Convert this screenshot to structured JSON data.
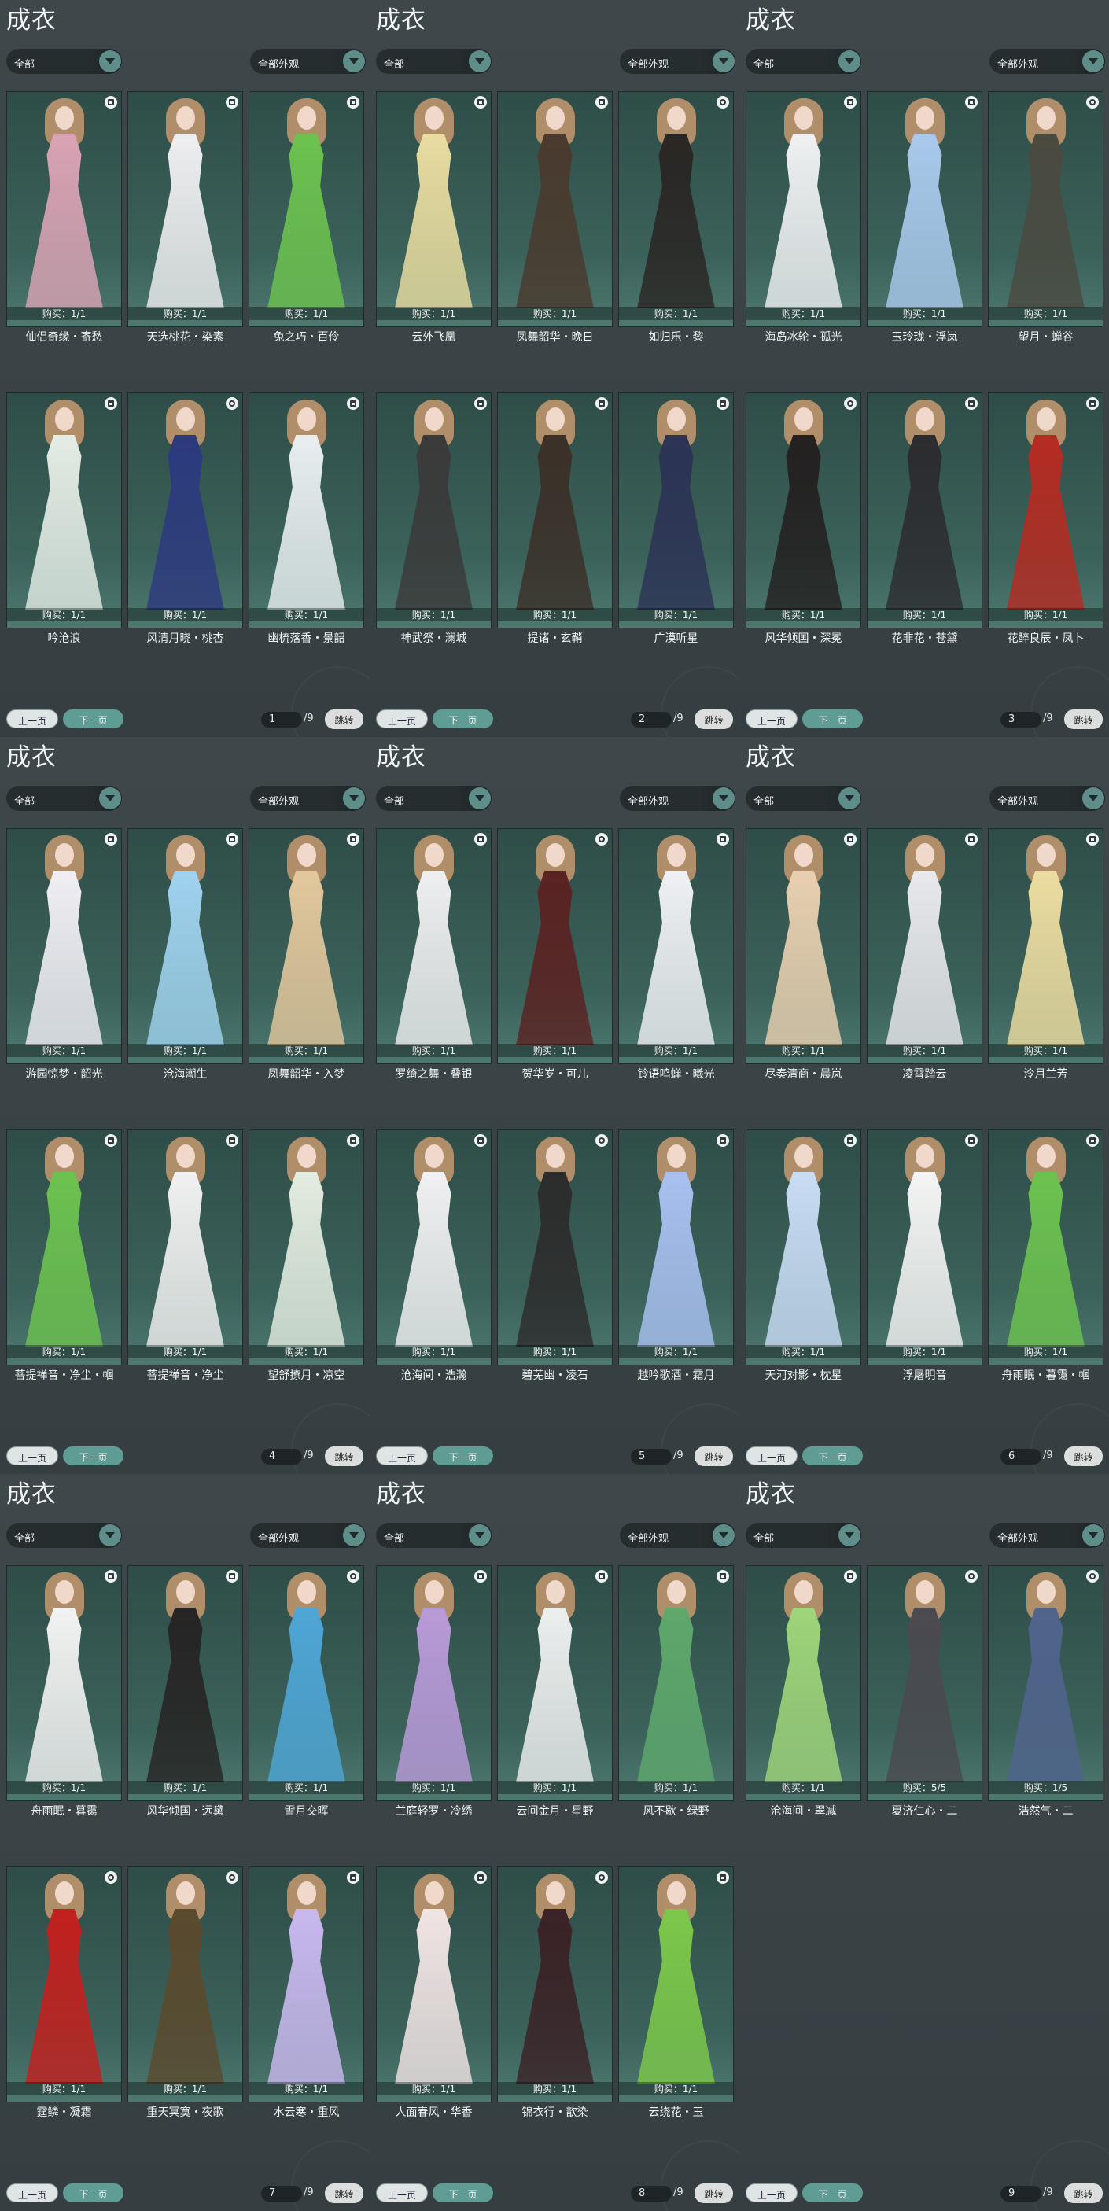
{
  "panels": [
    {
      "title": "成衣",
      "filter1": "全部",
      "filter2": "全部外观",
      "prev": "上一页",
      "next": "下一页",
      "page": "1",
      "total": "/9",
      "jump": "跳转",
      "cards": [
        {
          "name": "仙侣奇缘・寄愁",
          "price": "购买：1/1",
          "tag": "lock",
          "color": "#d9a3b4"
        },
        {
          "name": "天选桃花・染素",
          "price": "购买：1/1",
          "tag": "lock",
          "color": "#eeeef0"
        },
        {
          "name": "兔之巧・百伶",
          "price": "购买：1/1",
          "tag": "lock",
          "color": "#6cc24f"
        },
        {
          "name": "吟沧浪",
          "price": "购买：1/1",
          "tag": "lock",
          "color": "#e3ece5"
        },
        {
          "name": "风清月晓・桃杏",
          "price": "购买：1/1",
          "tag": "swap",
          "color": "#2c3a7e"
        },
        {
          "name": "幽梳落香・景韶",
          "price": "购买：1/1",
          "tag": "lock",
          "color": "#e8eef0"
        }
      ]
    },
    {
      "title": "成衣",
      "filter1": "全部",
      "filter2": "全部外观",
      "prev": "上一页",
      "next": "下一页",
      "page": "2",
      "total": "/9",
      "jump": "跳转",
      "cards": [
        {
          "name": "云外飞凰",
          "price": "购买：1/1",
          "tag": "lock",
          "color": "#e8dca0"
        },
        {
          "name": "凤舞韶华・晚日",
          "price": "购买：1/1",
          "tag": "lock",
          "color": "#4a3a2e"
        },
        {
          "name": "如归乐・黎",
          "price": "购买：1/1",
          "tag": "swap",
          "color": "#2a2624"
        },
        {
          "name": "神武祭・澜城",
          "price": "购买：1/1",
          "tag": "lock",
          "color": "#3a3a3a"
        },
        {
          "name": "提诸・玄鞘",
          "price": "购买：1/1",
          "tag": "lock",
          "color": "#3b3028"
        },
        {
          "name": "广漠听星",
          "price": "购买：1/1",
          "tag": "lock",
          "color": "#2c3355"
        }
      ]
    },
    {
      "title": "成衣",
      "filter1": "全部",
      "filter2": "全部外观",
      "prev": "上一页",
      "next": "下一页",
      "page": "3",
      "total": "/9",
      "jump": "跳转",
      "cards": [
        {
          "name": "海岛冰轮・孤光",
          "price": "购买：1/1",
          "tag": "lock",
          "color": "#eef0f2"
        },
        {
          "name": "玉玲珑・浮岚",
          "price": "购买：1/1",
          "tag": "lock",
          "color": "#a9c9ec"
        },
        {
          "name": "望月・蝉谷",
          "price": "购买：1/1",
          "tag": "swap",
          "color": "#4a4a40"
        },
        {
          "name": "风华倾国・深冕",
          "price": "购买：1/1",
          "tag": "swap",
          "color": "#232020"
        },
        {
          "name": "花非花・苍黛",
          "price": "购买：1/1",
          "tag": "lock",
          "color": "#2c2c30"
        },
        {
          "name": "花醉良辰・凤卜",
          "price": "购买：1/1",
          "tag": "lock",
          "color": "#b42b22"
        }
      ]
    },
    {
      "title": "成衣",
      "filter1": "全部",
      "filter2": "全部外观",
      "prev": "上一页",
      "next": "下一页",
      "page": "4",
      "total": "/9",
      "jump": "跳转",
      "cards": [
        {
          "name": "游园惊梦・韶光",
          "price": "购买：1/1",
          "tag": "lock",
          "color": "#f0eef4"
        },
        {
          "name": "沧海潮生",
          "price": "购买：1/1",
          "tag": "lock",
          "color": "#9fd2ee"
        },
        {
          "name": "凤舞韶华・入梦",
          "price": "购买：1/1",
          "tag": "lock",
          "color": "#e2c79c"
        },
        {
          "name": "菩提禅音・净尘・帼",
          "price": "购买：1/1",
          "tag": "lock",
          "color": "#6cc24f"
        },
        {
          "name": "菩提禅音・净尘",
          "price": "购买：1/1",
          "tag": "lock",
          "color": "#f0f0f0"
        },
        {
          "name": "望舒撩月・凉空",
          "price": "购买：1/1",
          "tag": "lock",
          "color": "#e3ece0"
        }
      ]
    },
    {
      "title": "成衣",
      "filter1": "全部",
      "filter2": "全部外观",
      "prev": "上一页",
      "next": "下一页",
      "page": "5",
      "total": "/9",
      "jump": "跳转",
      "cards": [
        {
          "name": "罗绮之舞・叠银",
          "price": "购买：1/1",
          "tag": "lock",
          "color": "#eeeef0"
        },
        {
          "name": "贺华岁・可儿",
          "price": "购买：1/1",
          "tag": "swap",
          "color": "#5a2222"
        },
        {
          "name": "铃语鸣蝉・曦光",
          "price": "购买：1/1",
          "tag": "lock",
          "color": "#eef0f4"
        },
        {
          "name": "沧海间・浩瀚",
          "price": "购买：1/1",
          "tag": "lock",
          "color": "#f0f0f2"
        },
        {
          "name": "碧芜幽・凌石",
          "price": "购买：1/1",
          "tag": "swap",
          "color": "#2c2c2c"
        },
        {
          "name": "越吟歌酒・霜月",
          "price": "购买：1/1",
          "tag": "lock",
          "color": "#a8c0f0"
        }
      ]
    },
    {
      "title": "成衣",
      "filter1": "全部",
      "filter2": "全部外观",
      "prev": "上一页",
      "next": "下一页",
      "page": "6",
      "total": "/9",
      "jump": "跳转",
      "cards": [
        {
          "name": "尽奏清商・晨岚",
          "price": "购买：1/1",
          "tag": "lock",
          "color": "#e8cfb0"
        },
        {
          "name": "凌霄踏云",
          "price": "购买：1/1",
          "tag": "lock",
          "color": "#e8e8ec"
        },
        {
          "name": "泠月兰芳",
          "price": "购买：1/1",
          "tag": "lock",
          "color": "#ecdca0"
        },
        {
          "name": "天河对影・枕星",
          "price": "购买：1/1",
          "tag": "lock",
          "color": "#c8dcf4"
        },
        {
          "name": "浮屠明音",
          "price": "购买：1/1",
          "tag": "lock",
          "color": "#f4f4f4"
        },
        {
          "name": "舟雨眠・暮霭・帼",
          "price": "购买：1/1",
          "tag": "lock",
          "color": "#6cc24f"
        }
      ]
    },
    {
      "title": "成衣",
      "filter1": "全部",
      "filter2": "全部外观",
      "prev": "上一页",
      "next": "下一页",
      "page": "7",
      "total": "/9",
      "jump": "跳转",
      "cards": [
        {
          "name": "舟雨眠・暮霭",
          "price": "购买：1/1",
          "tag": "lock",
          "color": "#f2f2f2"
        },
        {
          "name": "风华倾国・远黛",
          "price": "购买：1/1",
          "tag": "lock",
          "color": "#262424"
        },
        {
          "name": "雪月交晖",
          "price": "购买：1/1",
          "tag": "swap",
          "color": "#4ea6d6"
        },
        {
          "name": "霆鳞・凝霜",
          "price": "购买：1/1",
          "tag": "swap",
          "color": "#c2201e"
        },
        {
          "name": "重天冥寞・夜歌",
          "price": "购买：1/1",
          "tag": "swap",
          "color": "#5a4a2e"
        },
        {
          "name": "水云寒・重风",
          "price": "购买：1/1",
          "tag": "lock",
          "color": "#c8b8ee"
        }
      ]
    },
    {
      "title": "成衣",
      "filter1": "全部",
      "filter2": "全部外观",
      "prev": "上一页",
      "next": "下一页",
      "page": "8",
      "total": "/9",
      "jump": "跳转",
      "cards": [
        {
          "name": "兰庭轻罗・冷绣",
          "price": "购买：1/1",
          "tag": "lock",
          "color": "#b89ad8"
        },
        {
          "name": "云间金月・星野",
          "price": "购买：1/1",
          "tag": "lock",
          "color": "#eceeee"
        },
        {
          "name": "风不歇・绿野",
          "price": "购买：1/1",
          "tag": "lock",
          "color": "#5ea86c"
        },
        {
          "name": "人面春风・华香",
          "price": "购买：1/1",
          "tag": "lock",
          "color": "#f0e4e4"
        },
        {
          "name": "锦衣行・歆染",
          "price": "购买：1/1",
          "tag": "swap",
          "color": "#3a2226"
        },
        {
          "name": "云绕花・玉",
          "price": "购买：1/1",
          "tag": "lock",
          "color": "#7cc84a"
        }
      ]
    },
    {
      "title": "成衣",
      "filter1": "全部",
      "filter2": "全部外观",
      "prev": "上一页",
      "next": "下一页",
      "page": "9",
      "total": "/9",
      "jump": "跳转",
      "cards": [
        {
          "name": "沧海间・翠减",
          "price": "购买：1/1",
          "tag": "lock",
          "color": "#9ed47a"
        },
        {
          "name": "夏济仁心・二",
          "price": "购买：5/5",
          "tag": "swap",
          "color": "#4a4a50"
        },
        {
          "name": "浩然气・二",
          "price": "购买：1/5",
          "tag": "swap",
          "color": "#50648c"
        }
      ]
    }
  ]
}
